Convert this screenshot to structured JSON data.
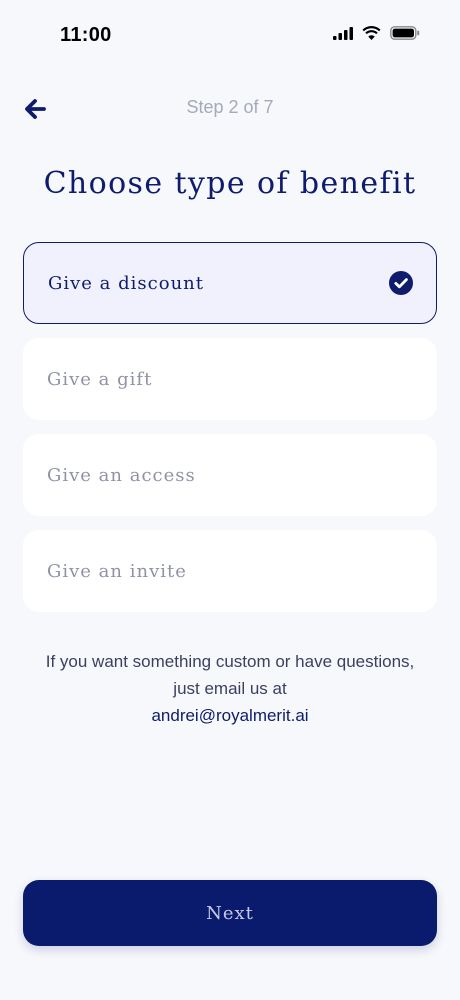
{
  "status_bar": {
    "time": "11:00",
    "icons": [
      "cellular-signal-icon",
      "wifi-icon",
      "battery-icon"
    ]
  },
  "header": {
    "back_icon": "arrow-left-icon",
    "step_label": "Step 2 of 7"
  },
  "title": "Choose type of benefit",
  "options": [
    {
      "label": "Give a discount",
      "selected": true
    },
    {
      "label": "Give a gift",
      "selected": false
    },
    {
      "label": "Give an access",
      "selected": false
    },
    {
      "label": "Give an invite",
      "selected": false
    }
  ],
  "help": {
    "text": "If you want something custom or have questions, just email us at",
    "email": "andrei@royalmerit.ai"
  },
  "next_button": {
    "label": "Next"
  },
  "colors": {
    "primary": "#0e1c6b",
    "button": "#0a1a6c",
    "background": "#f7f8fc",
    "option_selected_bg": "#f0f1fc",
    "muted_text": "#8f92a6",
    "step_text": "#a6a9b8"
  }
}
